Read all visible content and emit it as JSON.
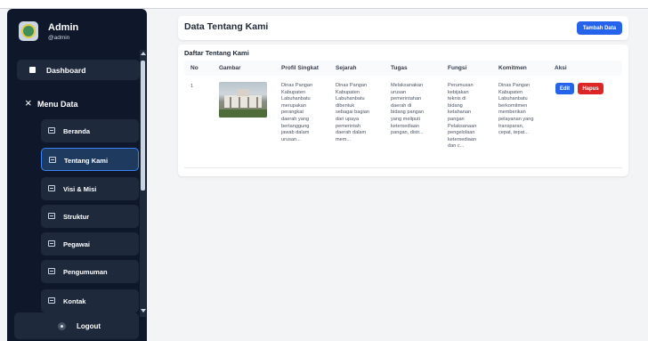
{
  "sidebar": {
    "user": {
      "name": "Admin",
      "handle": "@admin"
    },
    "dashboard_label": "Dashboard",
    "menu_group_label": "Menu Data",
    "menu_items": [
      {
        "label": "Beranda",
        "active": false
      },
      {
        "label": "Tentang Kami",
        "active": true
      },
      {
        "label": "Visi & Misi",
        "active": false
      },
      {
        "label": "Struktur",
        "active": false
      },
      {
        "label": "Pegawai",
        "active": false
      },
      {
        "label": "Pengumuman",
        "active": false
      },
      {
        "label": "Kontak",
        "active": false
      }
    ],
    "logout_label": "Logout"
  },
  "header": {
    "title": "Data Tentang Kami",
    "add_button": "Tambah Data"
  },
  "table": {
    "title": "Daftar Tentang Kami",
    "columns": [
      "No",
      "Gambar",
      "Profil Singkat",
      "Sejarah",
      "Tugas",
      "Fungsi",
      "Komitmen",
      "Aksi"
    ],
    "rows": [
      {
        "no": "1",
        "profil": "Dinas Pangan\nKabupaten\nLabuhanbatu\nmerupakan\nperangkat\ndaerah yang\nbertanggung\njawab dalam\nurusan...",
        "sejarah": "Dinas Pangan\nKabupaten\nLabuhanbatu\ndibentuk\nsebagai bagian\ndari upaya\npemerintah\ndaerah dalam\nmem...",
        "tugas": "Melaksanakan\nurusan\npemerintahan\ndaerah di\nbidang pangan\nyang meliputi\nketersediaan\npangan, distr...",
        "fungsi": "Perumusan\nkebijakan\nteknis di\nbidang\nketahanan\npangan\nPelaksanaan\npengelolaan\nketersediaan\ndan c...",
        "komitmen": "Dinas Pangan\nKabupaten\nLabuhanbatu\nberkomitmen\nmemberikan\npelayanan yang\ntransparan,\ncepat, tepat...",
        "edit_label": "Edit",
        "delete_label": "Hapus"
      }
    ]
  },
  "colors": {
    "sidebar_bg": "#0f172a",
    "active_item_border": "#3b82f6",
    "primary": "#2563eb",
    "danger": "#dc2626"
  }
}
